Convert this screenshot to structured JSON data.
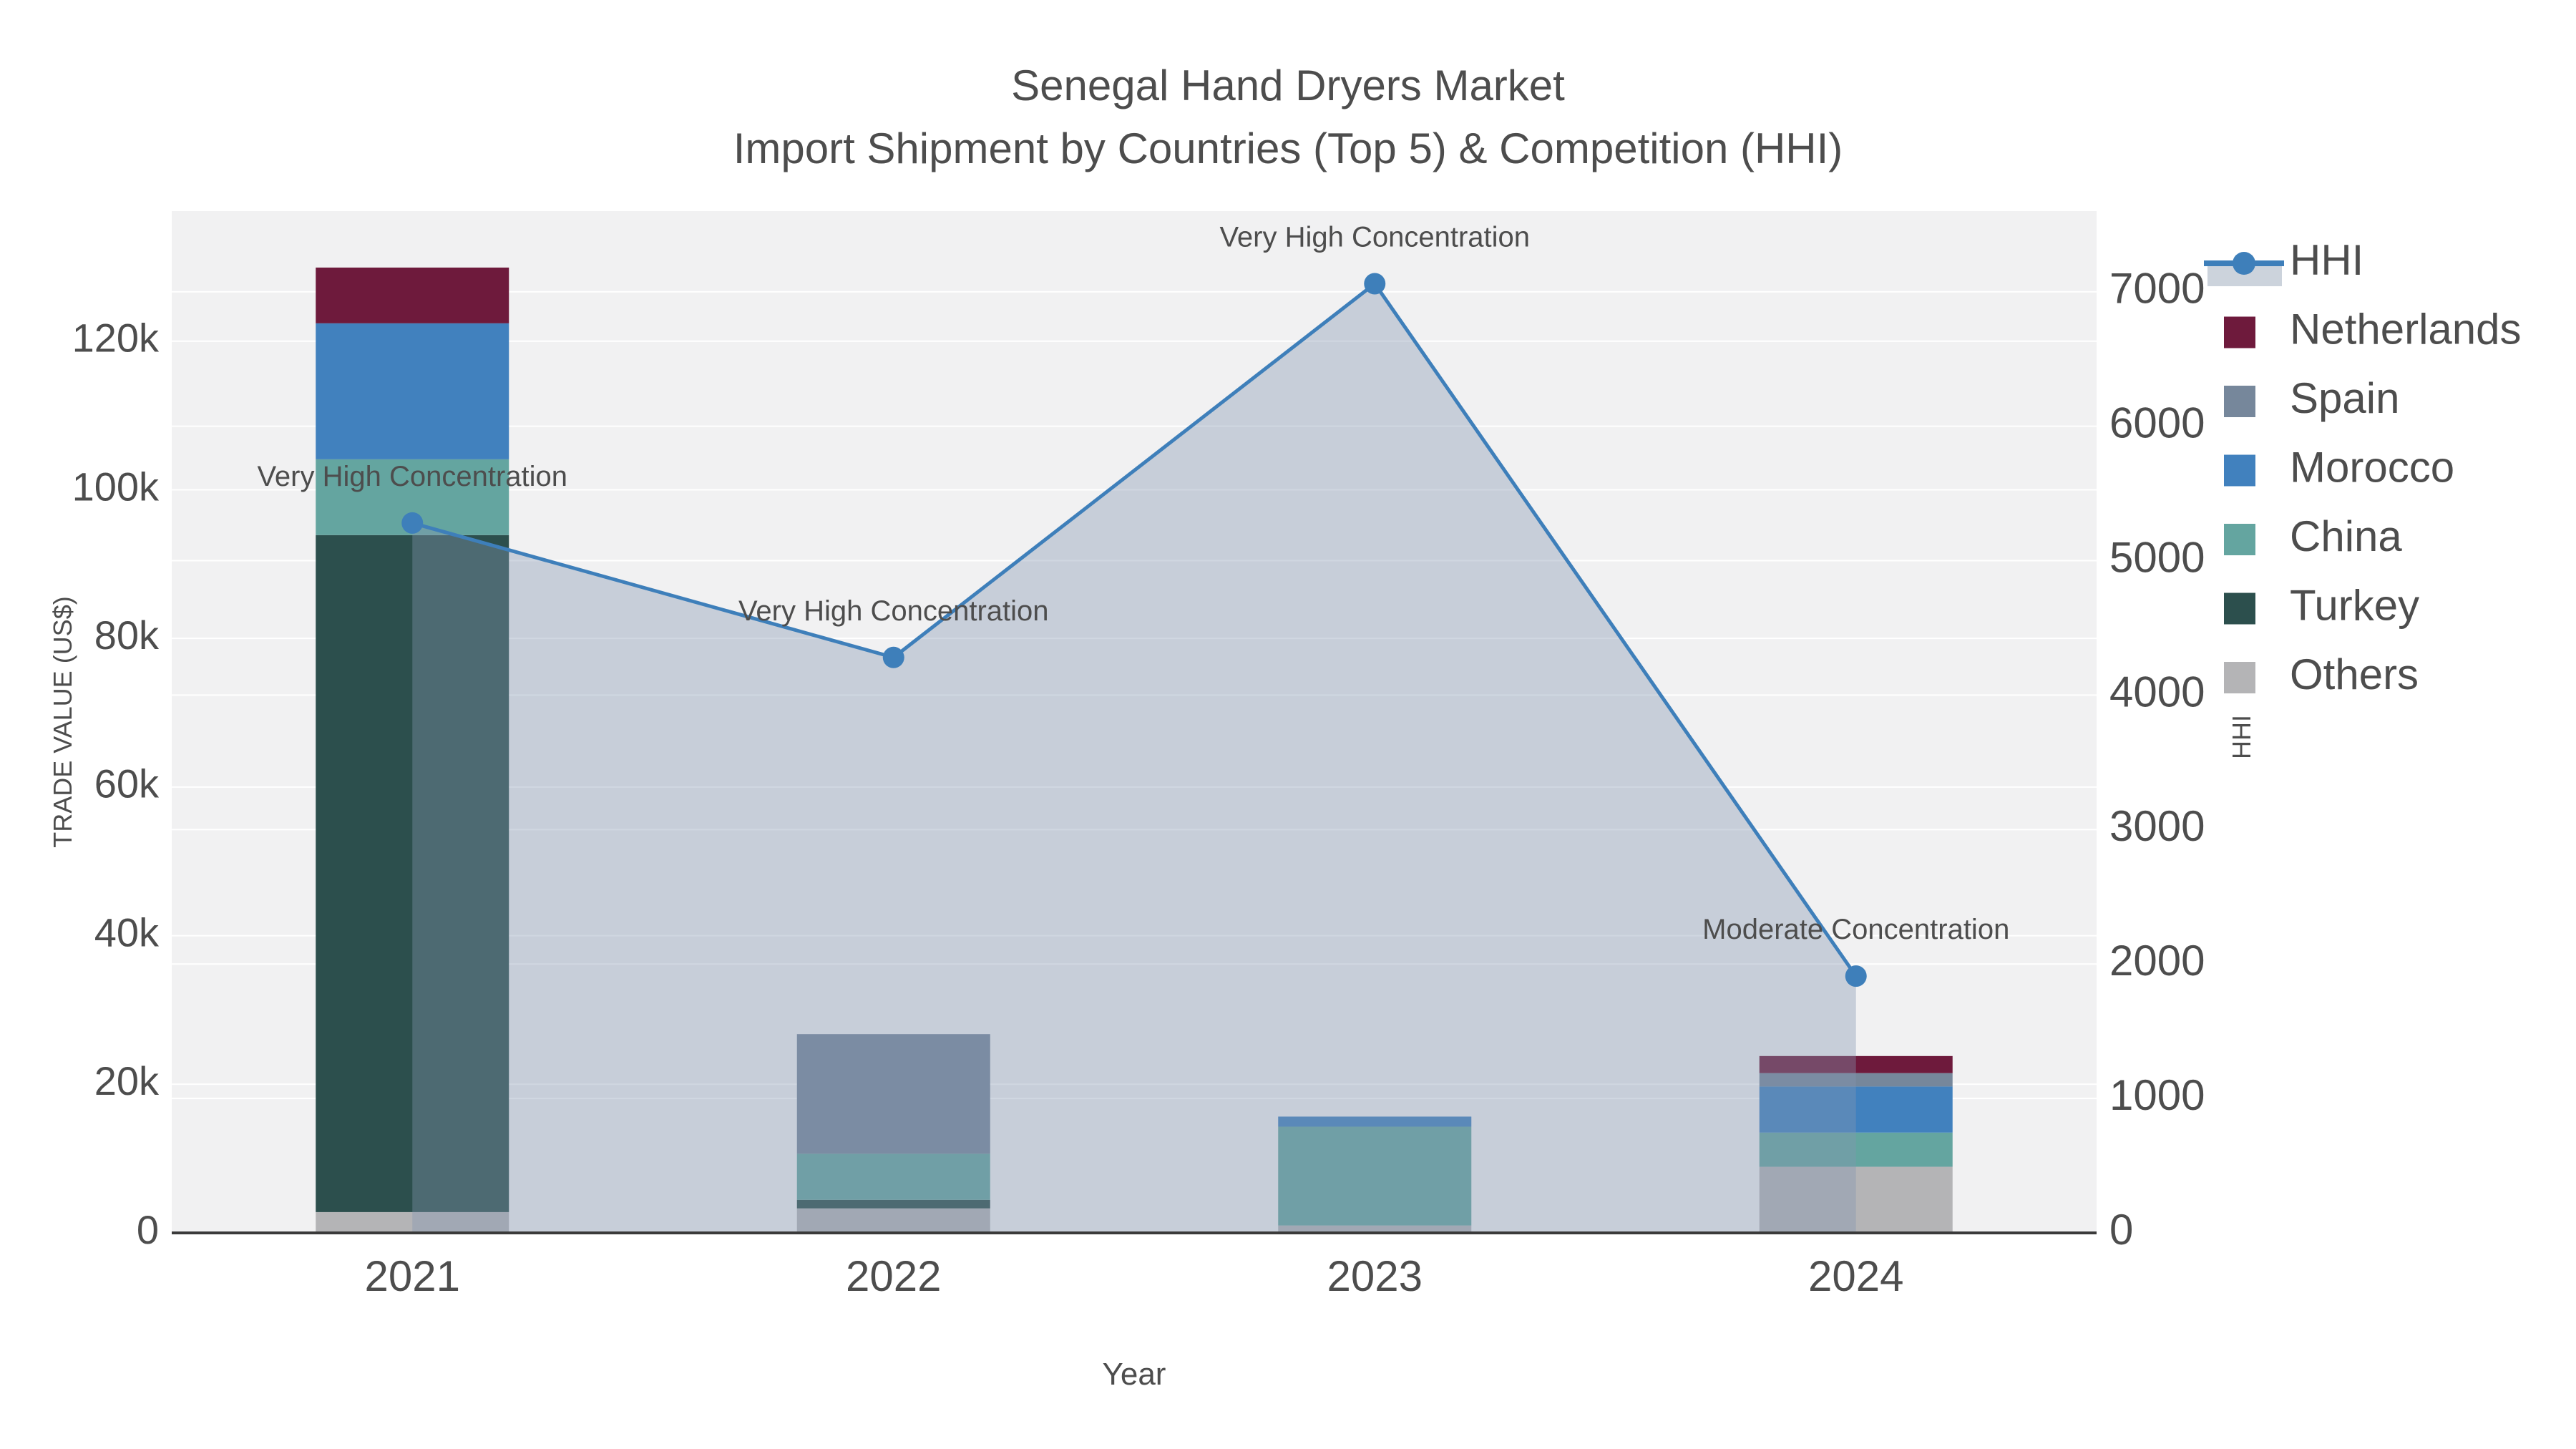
{
  "style": {
    "page_bg": "#ffffff",
    "plot_bg": "#f1f1f2",
    "grid_color": "#ffffff",
    "axis_line_color": "#3a3a3a",
    "text_color": "#4d4d4d",
    "annotation_color": "#000000"
  },
  "chart_data": {
    "type": "bar-line-combo",
    "title": "Senegal Hand Dryers Market",
    "subtitle": "Import Shipment by Countries (Top 5) & Competition (HHI)",
    "xlabel": "Year",
    "ylabel_left": "TRADE VALUE (US$)",
    "ylabel_right": "HHI",
    "categories": [
      "2021",
      "2022",
      "2023",
      "2024"
    ],
    "bar_stack_order_note": "bottom to top",
    "bar_series": [
      {
        "name": "Others",
        "color": "#b4b4b6",
        "values": [
          2800,
          3300,
          1000,
          8900
        ]
      },
      {
        "name": "Turkey",
        "color": "#2c4f4d",
        "values": [
          91100,
          1150,
          0,
          0
        ]
      },
      {
        "name": "China",
        "color": "#64a5a0",
        "values": [
          10200,
          6200,
          13300,
          4600
        ]
      },
      {
        "name": "Morocco",
        "color": "#4181be",
        "values": [
          18300,
          0,
          1350,
          6200
        ]
      },
      {
        "name": "Spain",
        "color": "#76879b",
        "values": [
          0,
          16100,
          0,
          1800
        ]
      },
      {
        "name": "Netherlands",
        "color": "#6e1a3c",
        "values": [
          7500,
          0,
          0,
          2300
        ]
      }
    ],
    "line_series": {
      "name": "HHI",
      "color": "#3e7fba",
      "fill_color": "rgba(132,150,175,0.38)",
      "values": [
        5280,
        4280,
        7060,
        1910
      ]
    },
    "annotations": [
      {
        "text": "Very High Concentration",
        "category_index": 0
      },
      {
        "text": "Very High Concentration",
        "category_index": 1
      },
      {
        "text": "Very High Concentration",
        "category_index": 2
      },
      {
        "text": "Moderate Concentration",
        "category_index": 3
      }
    ],
    "left_axis": {
      "tick_labels": [
        "0",
        "20k",
        "40k",
        "60k",
        "80k",
        "100k",
        "120k"
      ],
      "tick_values": [
        0,
        20000,
        40000,
        60000,
        80000,
        100000,
        120000
      ],
      "range": [
        0,
        137500
      ]
    },
    "right_axis": {
      "tick_labels": [
        "0",
        "1000",
        "2000",
        "3000",
        "4000",
        "5000",
        "6000",
        "7000"
      ],
      "tick_values": [
        0,
        1000,
        2000,
        3000,
        4000,
        5000,
        6000,
        7000
      ],
      "range": [
        0,
        7600
      ]
    },
    "legend": {
      "items": [
        "HHI",
        "Netherlands",
        "Spain",
        "Morocco",
        "China",
        "Turkey",
        "Others"
      ]
    },
    "grid": true,
    "legend_position": "top-right"
  }
}
